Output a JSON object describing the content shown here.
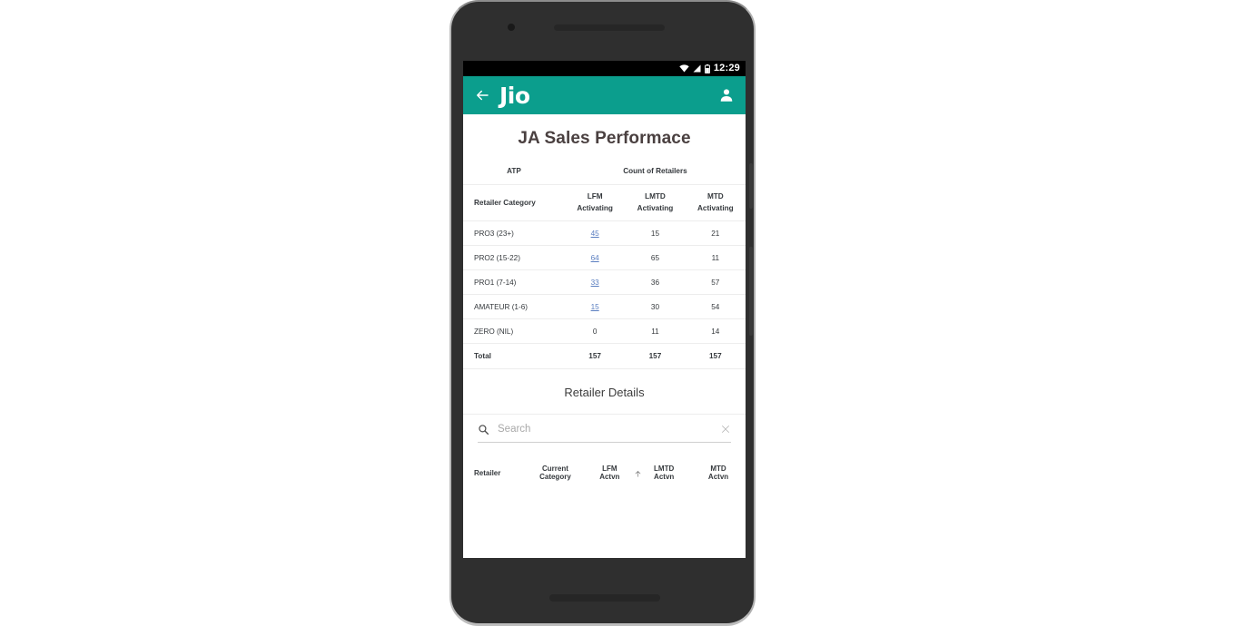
{
  "status_bar": {
    "time": "12:29",
    "icons": [
      "wifi-icon",
      "signal-icon",
      "battery-icon"
    ]
  },
  "app_bar": {
    "back_label": "back-arrow-icon",
    "brand": "Jio",
    "profile_label": "person-icon",
    "background_color": "#0b9e8d"
  },
  "page": {
    "title": "JA Sales Performace"
  },
  "summary_table": {
    "group_headers": {
      "left": "ATP",
      "right": "Count of Retailers"
    },
    "columns": [
      {
        "line1": "Retailer Category",
        "line2": ""
      },
      {
        "line1": "LFM",
        "line2": "Activating"
      },
      {
        "line1": "LMTD",
        "line2": "Activating"
      },
      {
        "line1": "MTD",
        "line2": "Activating"
      }
    ],
    "rows": [
      {
        "category": "PRO3 (23+)",
        "lfm": "45",
        "lfm_link": true,
        "lmtd": "15",
        "mtd": "21",
        "mtd_red": false
      },
      {
        "category": "PRO2 (15-22)",
        "lfm": "64",
        "lfm_link": true,
        "lmtd": "65",
        "mtd": "11",
        "mtd_red": true
      },
      {
        "category": "PRO1 (7-14)",
        "lfm": "33",
        "lfm_link": true,
        "lmtd": "36",
        "mtd": "57",
        "mtd_red": false
      },
      {
        "category": "AMATEUR (1-6)",
        "lfm": "15",
        "lfm_link": true,
        "lmtd": "30",
        "mtd": "54",
        "mtd_red": true
      },
      {
        "category": "ZERO (NIL)",
        "lfm": "0",
        "lfm_link": false,
        "lmtd": "11",
        "mtd": "14",
        "mtd_red": true
      }
    ],
    "total_row": {
      "category": "Total",
      "lfm": "157",
      "lmtd": "157",
      "mtd": "157"
    },
    "link_color": "#5a7ec0",
    "negative_color": "#e0383b"
  },
  "retailer_details": {
    "title": "Retailer Details",
    "search": {
      "placeholder": "Search",
      "value": "",
      "search_icon": "search-icon",
      "clear_icon": "close-icon"
    },
    "columns": [
      {
        "line1": "Retailer",
        "line2": ""
      },
      {
        "line1": "Current",
        "line2": "Category"
      },
      {
        "line1": "LFM",
        "line2": "Actvn",
        "sorted": true,
        "sort_direction": "asc"
      },
      {
        "line1": "LMTD",
        "line2": "Actvn"
      },
      {
        "line1": "MTD",
        "line2": "Actvn"
      }
    ]
  },
  "nav_bar": {
    "back": "back-triangle-icon",
    "home": "home-circle-icon",
    "recents": "recents-square-icon"
  }
}
